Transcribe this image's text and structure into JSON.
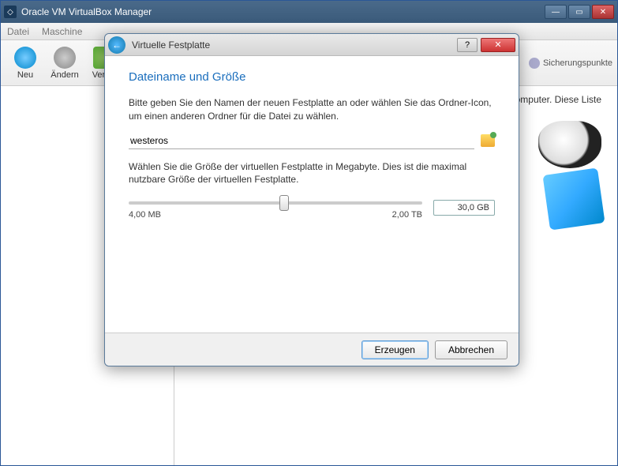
{
  "main": {
    "title": "Oracle VM VirtualBox Manager",
    "menu": {
      "datei": "Datei",
      "maschine": "Maschine"
    },
    "toolbar": {
      "neu": "Neu",
      "aendern": "Ändern",
      "verwerfen": "Verwe",
      "sicherung": "Sicherungspunkte"
    },
    "details_snippet": "Computer. Diese Liste"
  },
  "dialog": {
    "title": "Virtuelle Festplatte",
    "heading": "Dateiname und Größe",
    "name_hint": "Bitte geben Sie den Namen der neuen Festplatte an oder wählen Sie das Ordner-Icon, um einen anderen Ordner für die Datei zu wählen.",
    "filename": "westeros",
    "size_hint": "Wählen Sie die Größe der virtuellen Festplatte in Megabyte. Dies ist die maximal nutzbare Größe der virtuellen Festplatte.",
    "slider": {
      "min_label": "4,00 MB",
      "max_label": "2,00 TB",
      "value": 53
    },
    "size_display": "30,0 GB",
    "buttons": {
      "create": "Erzeugen",
      "cancel": "Abbrechen"
    }
  }
}
